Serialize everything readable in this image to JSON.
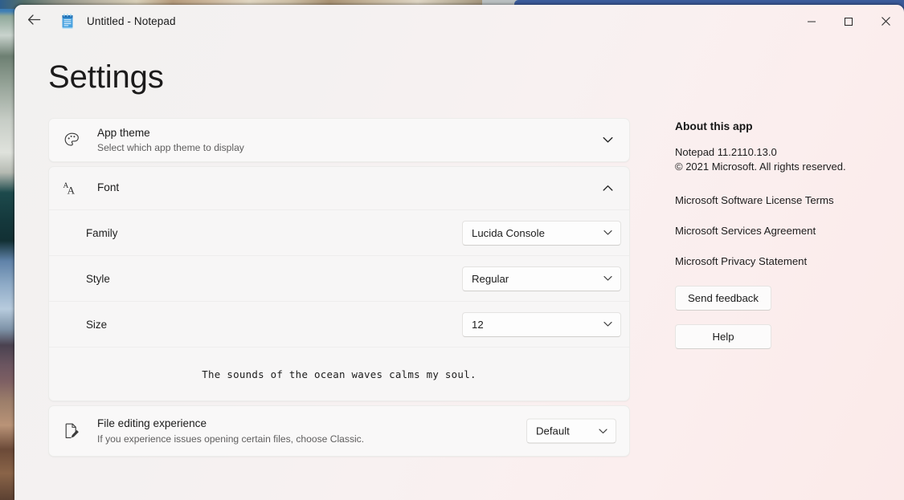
{
  "titlebar": {
    "back_icon": "back-arrow-icon",
    "app_icon": "notepad-icon",
    "title": "Untitled - Notepad",
    "minimize_label": "Minimize",
    "maximize_label": "Maximize",
    "close_label": "Close"
  },
  "page": {
    "title": "Settings"
  },
  "settings": {
    "app_theme": {
      "icon": "palette-icon",
      "title": "App theme",
      "subtitle": "Select which app theme to display",
      "chevron": "chevron-down-icon",
      "expanded": false
    },
    "font": {
      "icon": "font-aa-icon",
      "title": "Font",
      "chevron": "chevron-up-icon",
      "expanded": true,
      "rows": [
        {
          "label": "Family",
          "value": "Lucida Console",
          "caret": "chevron-down-icon"
        },
        {
          "label": "Style",
          "value": "Regular",
          "caret": "chevron-down-icon"
        },
        {
          "label": "Size",
          "value": "12",
          "caret": "chevron-down-icon"
        }
      ],
      "preview_text": "The sounds of the ocean waves calms my soul."
    },
    "file_editing": {
      "icon": "page-edit-icon",
      "title": "File editing experience",
      "subtitle": "If you experience issues opening certain files, choose Classic.",
      "value": "Default",
      "caret": "chevron-down-icon"
    }
  },
  "about": {
    "heading": "About this app",
    "version": "Notepad 11.2110.13.0",
    "copyright": "© 2021 Microsoft. All rights reserved.",
    "links": [
      "Microsoft Software License Terms",
      "Microsoft Services Agreement",
      "Microsoft Privacy Statement"
    ],
    "send_feedback_label": "Send feedback",
    "help_label": "Help"
  },
  "colors": {
    "window_bg_left": "#f2f1f0",
    "window_bg_right": "#fbeae9",
    "card_bg": "#f9f8f8",
    "text_primary": "#1b1b1b",
    "text_secondary": "#5f5e5e",
    "accent_icon_blue": "#3f8fd4"
  }
}
